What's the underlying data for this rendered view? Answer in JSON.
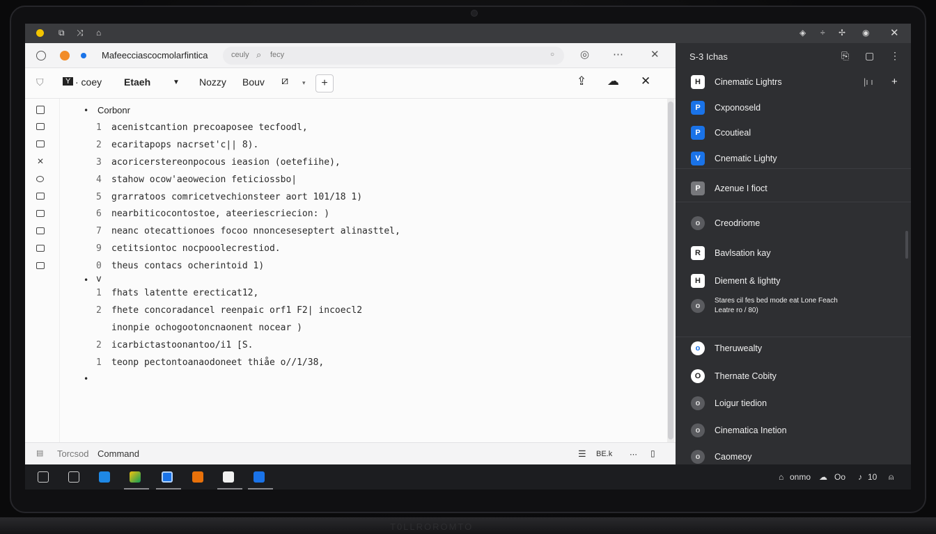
{
  "titlebar": {
    "icons": [
      "yellow-dot",
      "link-icon",
      "shuffle-icon",
      "close-small-icon"
    ],
    "right": [
      "wifi-icon",
      "minus-icon",
      "expand-icon",
      "record-icon",
      "close-icon"
    ]
  },
  "tab": {
    "title": "Mafeecciascocmolarfintica",
    "search_text_left": "ceuly",
    "search_text": "fecy"
  },
  "toolbar": {
    "item1": "· coey",
    "item2": "Etaeh",
    "item3": "Nozzy",
    "item4": "Bouv",
    "add_label": "+"
  },
  "document": {
    "heading": "Corbonr",
    "lines1": [
      {
        "num": "1",
        "text": "acenistcantion precoaposee tecfoodl,"
      },
      {
        "num": "2",
        "text": "ecaritapops nacrset'c|| 8)."
      },
      {
        "num": "3",
        "text": "acoricerstereonpocous ieasion (oetefiihe),"
      },
      {
        "num": "4",
        "text": "stahow ocow'aeowecion feticiossbo|"
      },
      {
        "num": "5",
        "text": "grarratoos comricetvechionsteer aort 101/18 1)"
      },
      {
        "num": "6",
        "text": "nearbiticocontostoe, ateeriescriecion: )"
      },
      {
        "num": "7",
        "text": "neanc otecattionoes focoo nnonceseseptert alinasttel,"
      },
      {
        "num": "9",
        "text": "cetitsiontoc nocpooolecrestiod."
      },
      {
        "num": "0",
        "text": "theus contacs ocherintoid 1)"
      }
    ],
    "chevron": "v",
    "lines2": [
      {
        "num": "1",
        "text": "fhats latentte erecticat12,"
      },
      {
        "num": "2",
        "text": "fhete concoradancel reenpaic orf1 F2| incoecl2"
      },
      {
        "num": "",
        "text": "inonpie ochogootoncnaonent nocear )"
      },
      {
        "num": "2",
        "text": "icarbictastoonantoo/i1 [S."
      },
      {
        "num": "1",
        "text": "teonp pectontoanaodoneet thiåe o//1/38,"
      }
    ]
  },
  "status": {
    "left1": "Torcsod",
    "left2": "Command",
    "right": "BE.k"
  },
  "sidebar": {
    "title": "S-3 Ichas",
    "items": [
      {
        "label": "Cinematic Lightrs",
        "icon": "H",
        "color": "#ffffff",
        "fg": "#222222",
        "extra": "|ı ı"
      },
      {
        "label": "Cxponoseld",
        "icon": "P",
        "color": "#1a73e8",
        "fg": "#ffffff"
      },
      {
        "label": "Ccoutieal",
        "icon": "P",
        "color": "#1a73e8",
        "fg": "#ffffff"
      },
      {
        "label": "Cnematic Lighty",
        "icon": "V",
        "color": "#1a73e8",
        "fg": "#ffffff"
      },
      {
        "label": "Azenue I fioct",
        "icon": "P",
        "color": "#77787c",
        "fg": "#ffffff"
      },
      {
        "label": "Creodriome",
        "icon": "o",
        "color": "#5a5b5f",
        "fg": "#dddddd"
      },
      {
        "label": "Bavlsation kay",
        "icon": "R",
        "color": "#ffffff",
        "fg": "#222222"
      },
      {
        "label": "Diement & lightty",
        "icon": "H",
        "color": "#ffffff",
        "fg": "#222222"
      },
      {
        "label": "Stares cil fes bed mode eat Lone Feach",
        "label2": "Leatre ro / 80)",
        "icon": "o",
        "color": "#5a5b5f",
        "fg": "#dddddd"
      },
      {
        "label": "Theruwealty",
        "icon": "o",
        "color": "#ffffff",
        "fg": "#1a73e8"
      },
      {
        "label": "Thernate Cobity",
        "icon": "O",
        "color": "#ffffff",
        "fg": "#222222"
      },
      {
        "label": "Loigur tiedion",
        "icon": "o",
        "color": "#5a5b5f",
        "fg": "#dddddd"
      },
      {
        "label": "Cinematica Inetion",
        "icon": "o",
        "color": "#5a5b5f",
        "fg": "#dddddd"
      },
      {
        "label": "Caomeoy",
        "icon": "o",
        "color": "#5a5b5f",
        "fg": "#dddddd"
      }
    ]
  },
  "taskbar": {
    "apps": [
      "mail-app-icon",
      "chat-app-icon",
      "store-app-icon",
      "photos-app-icon",
      "browser-app-icon",
      "files-app-icon",
      "terminal-app-icon",
      "share-app-icon"
    ],
    "tray": {
      "t1": "onmo",
      "t2": "Oo",
      "t3": "10"
    }
  },
  "base_text": "T0LLROROMTO"
}
